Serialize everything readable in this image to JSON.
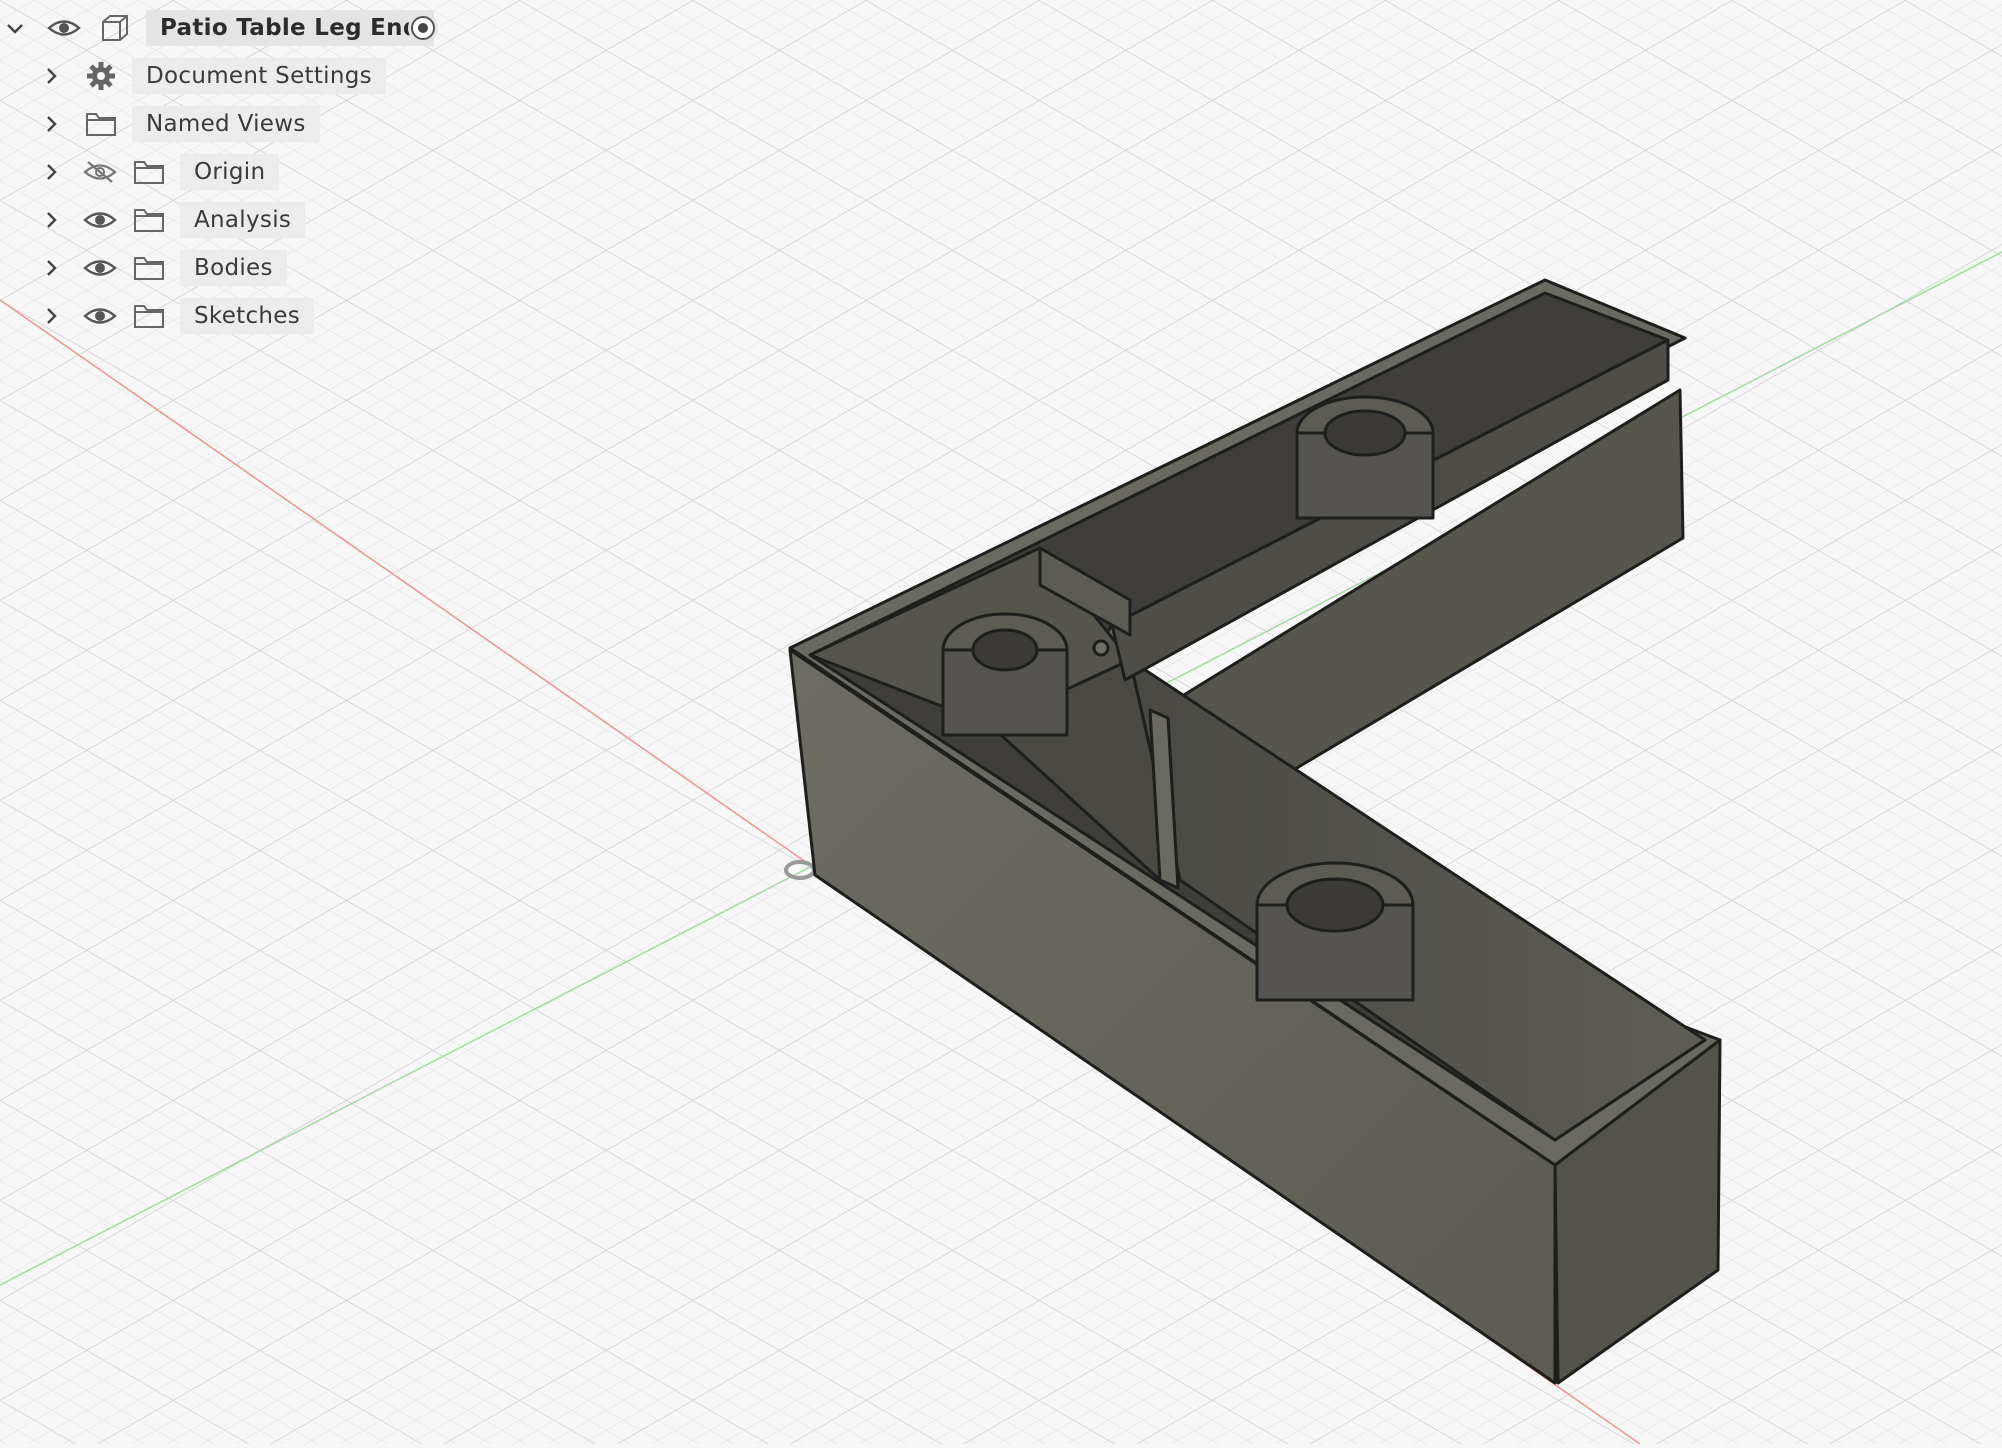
{
  "browser": {
    "root": {
      "label": "Patio Table Leg End",
      "expanded": true,
      "visible": true,
      "icon": "component-icon",
      "active": true
    },
    "items": [
      {
        "label": "Document Settings",
        "icon": "gear-icon",
        "visibility": "none"
      },
      {
        "label": "Named Views",
        "icon": "folder-icon",
        "visibility": "none"
      },
      {
        "label": "Origin",
        "icon": "folder-icon",
        "visibility": "hidden"
      },
      {
        "label": "Analysis",
        "icon": "folder-icon",
        "visibility": "visible"
      },
      {
        "label": "Bodies",
        "icon": "folder-icon",
        "visibility": "visible"
      },
      {
        "label": "Sketches",
        "icon": "folder-icon",
        "visibility": "visible"
      }
    ]
  },
  "colors": {
    "background": "#f7f7f7",
    "grid_minor": "#e2e2e2",
    "grid_major": "#cfcfcf",
    "axis_x": "#e8a0a0",
    "axis_y": "#9fd79f",
    "body_face": "#5f5e57",
    "body_side": "#6a6961",
    "body_edge": "#1e1e1c"
  }
}
